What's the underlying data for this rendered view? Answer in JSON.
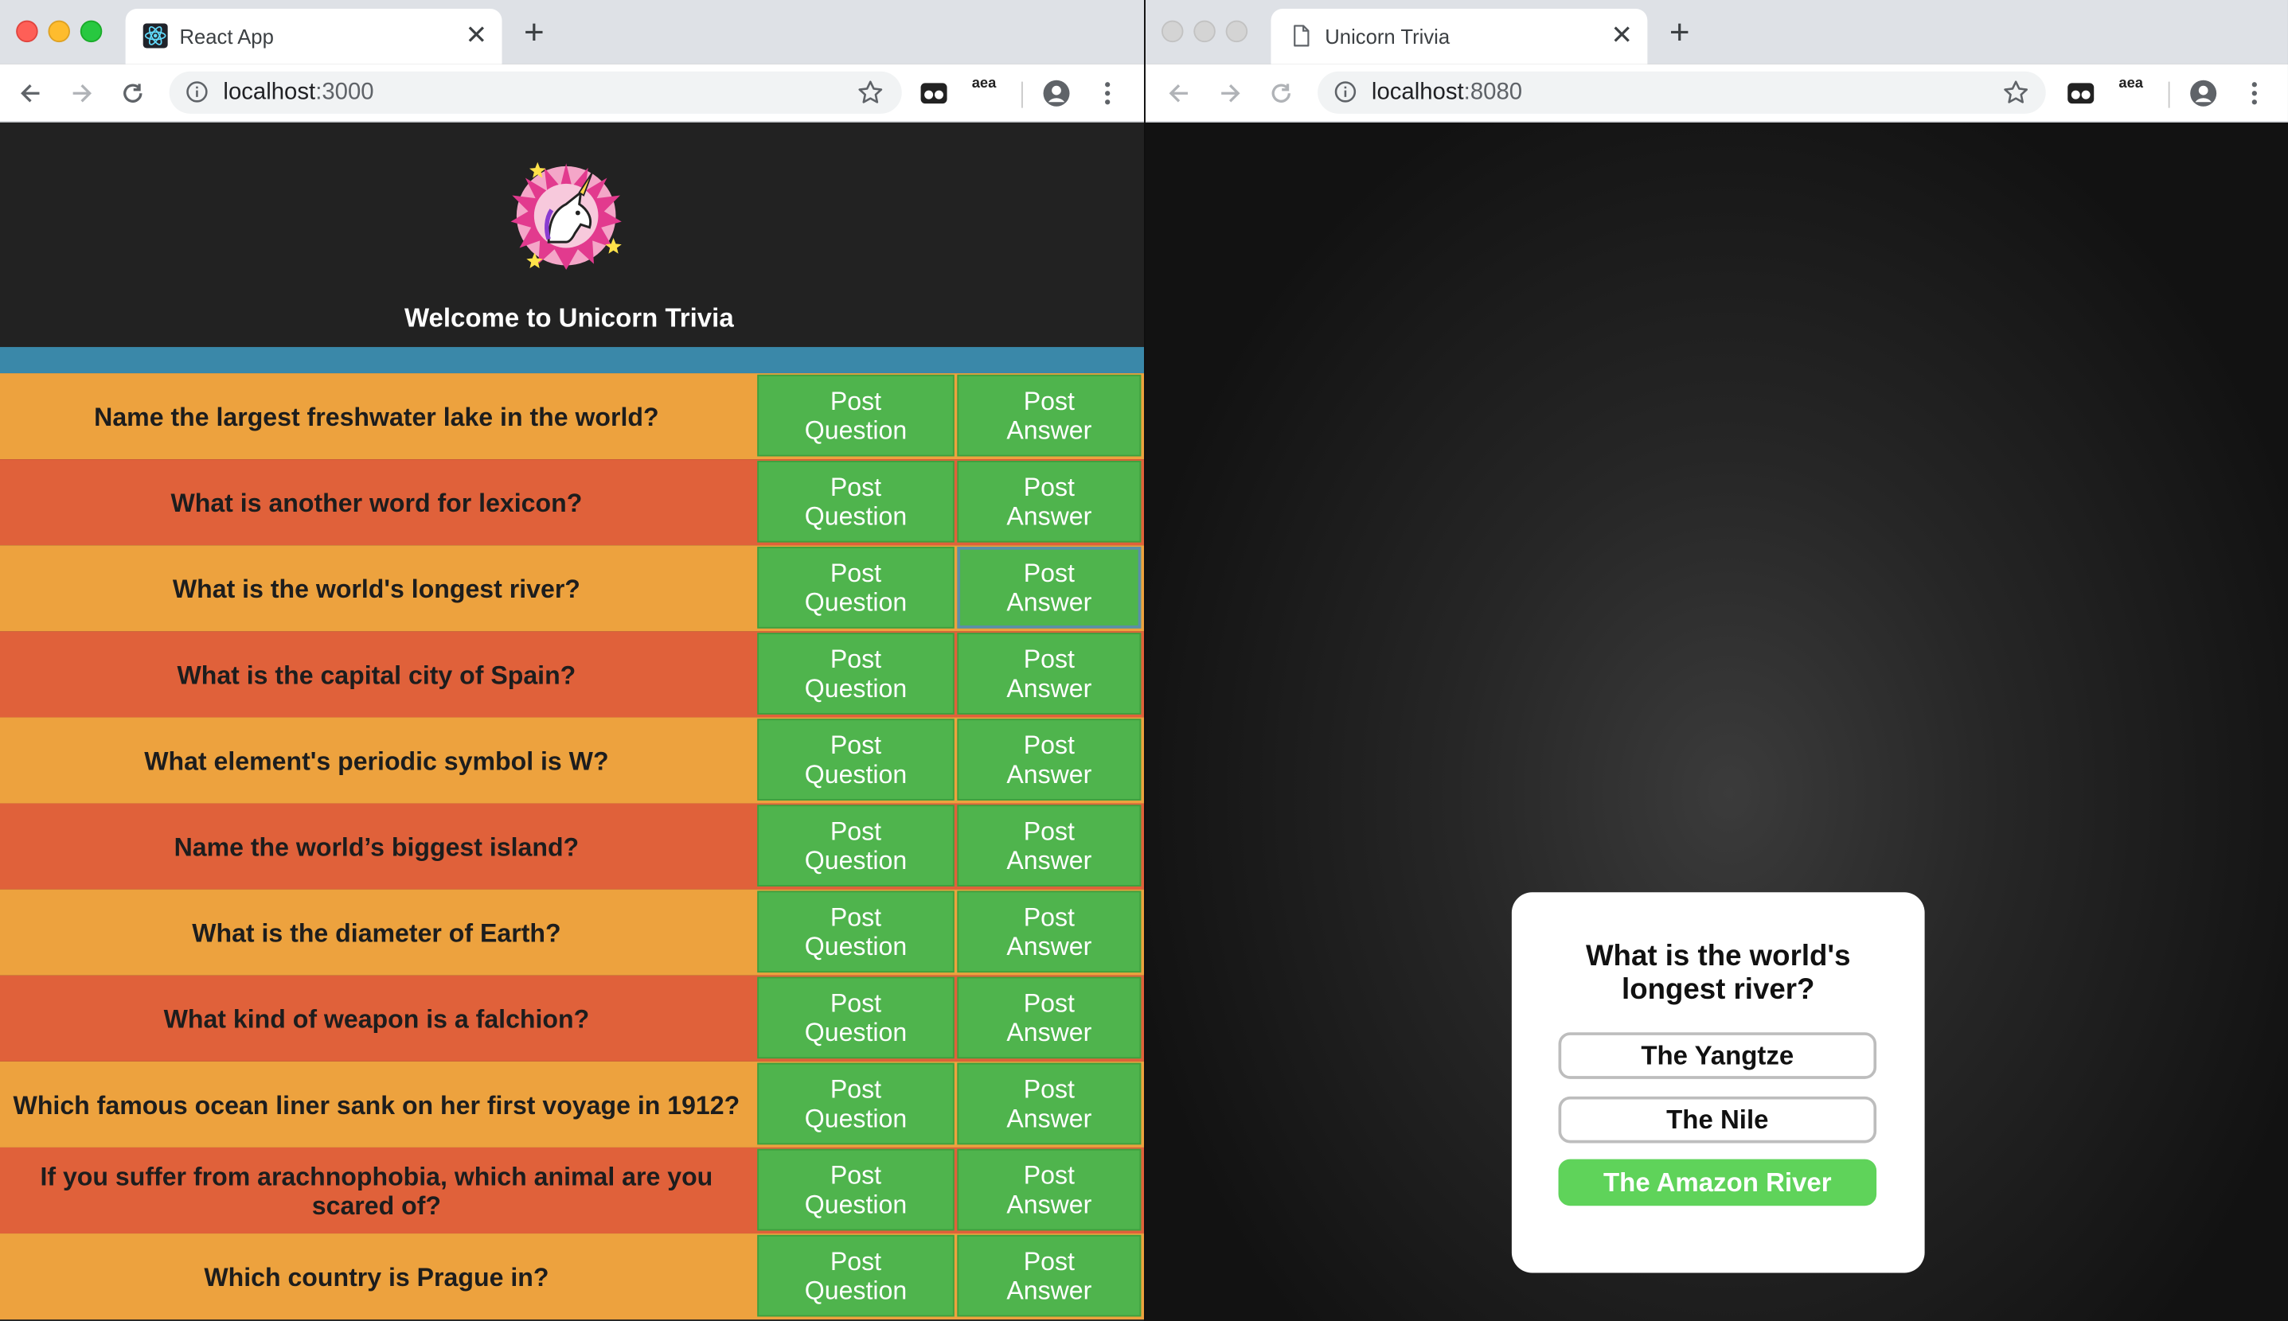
{
  "left_window": {
    "tab_title": "React App",
    "favicon": "react-atom-icon",
    "url_host": "localhost",
    "url_port": ":3000",
    "ext_amazon_label": "aea",
    "app": {
      "title": "Welcome to Unicorn Trivia",
      "logo": "unicorn-logo",
      "post_question_label": "Post Question",
      "post_answer_label": "Post Answer",
      "questions": [
        "Name the largest freshwater lake in the world?",
        "What is another word for lexicon?",
        "What is the world's longest river?",
        "What is the capital city of Spain?",
        "What element's periodic symbol is W?",
        "Name the world’s biggest island?",
        "What is the diameter of Earth?",
        "What kind of weapon is a falchion?",
        "Which famous ocean liner sank on her first voyage in 1912?",
        "If you suffer from arachnophobia, which animal are you scared of?",
        "Which country is Prague in?"
      ]
    }
  },
  "right_window": {
    "tab_title": "Unicorn Trivia",
    "favicon": "document-icon",
    "url_host": "localhost",
    "url_port": ":8080",
    "ext_amazon_label": "aea",
    "card": {
      "question": "What is the world's longest river?",
      "answers": [
        "The Yangtze",
        "The Nile",
        "The Amazon River"
      ],
      "correct_index": 2
    }
  },
  "colors": {
    "row_odd": "#eda23e",
    "row_even": "#e0613a",
    "button_green": "#4fb44d",
    "band_blue": "#3a88a9",
    "correct_green": "#5fd35a"
  }
}
